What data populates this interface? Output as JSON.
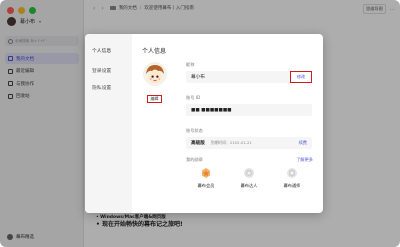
{
  "sidebar": {
    "user_name": "幕小布",
    "search_placeholder": "全局搜索 ⌘+⇧+F",
    "items": [
      {
        "label": "我的文档"
      },
      {
        "label": "最近编辑"
      },
      {
        "label": "与我协作"
      },
      {
        "label": "回收站"
      }
    ],
    "footer_label": "幕布精选"
  },
  "topbar": {
    "crumb_folder": "我的文档",
    "crumb_doc": "欢迎使用幕布丨入门指南",
    "btn_mindmap": "思维导图",
    "btn_more": "⋯"
  },
  "doc": {
    "line1": "移动端（手机/iPad）",
    "line2": "Windows/Mac客户端&网页版",
    "line3": "现在开始畅快的幕布记之旅吧!"
  },
  "modal": {
    "tabs": [
      "个人信息",
      "登录设置",
      "隐私设置"
    ],
    "title": "个人信息",
    "edit_label": "编辑",
    "nickname_label": "昵称",
    "nickname_value": "幕小布",
    "modify_label": "修改",
    "account_id_label": "账号 ID",
    "account_id_value": "■■ ■■■■■■■",
    "account_status_label": "账号状态",
    "plan_name": "高级版",
    "plan_expire": "到期时间：2102-01-21",
    "renew_label": "续费",
    "medals_label": "我的勋章",
    "learn_more": "了解更多",
    "medals": [
      {
        "label": "幕布会员"
      },
      {
        "label": "幕布达人"
      },
      {
        "label": "幕布通师"
      }
    ]
  },
  "colors": {
    "accent": "#4a4fd6",
    "highlight_border": "#d21b1b",
    "overlay": "rgba(0,0,0,0.32)"
  }
}
